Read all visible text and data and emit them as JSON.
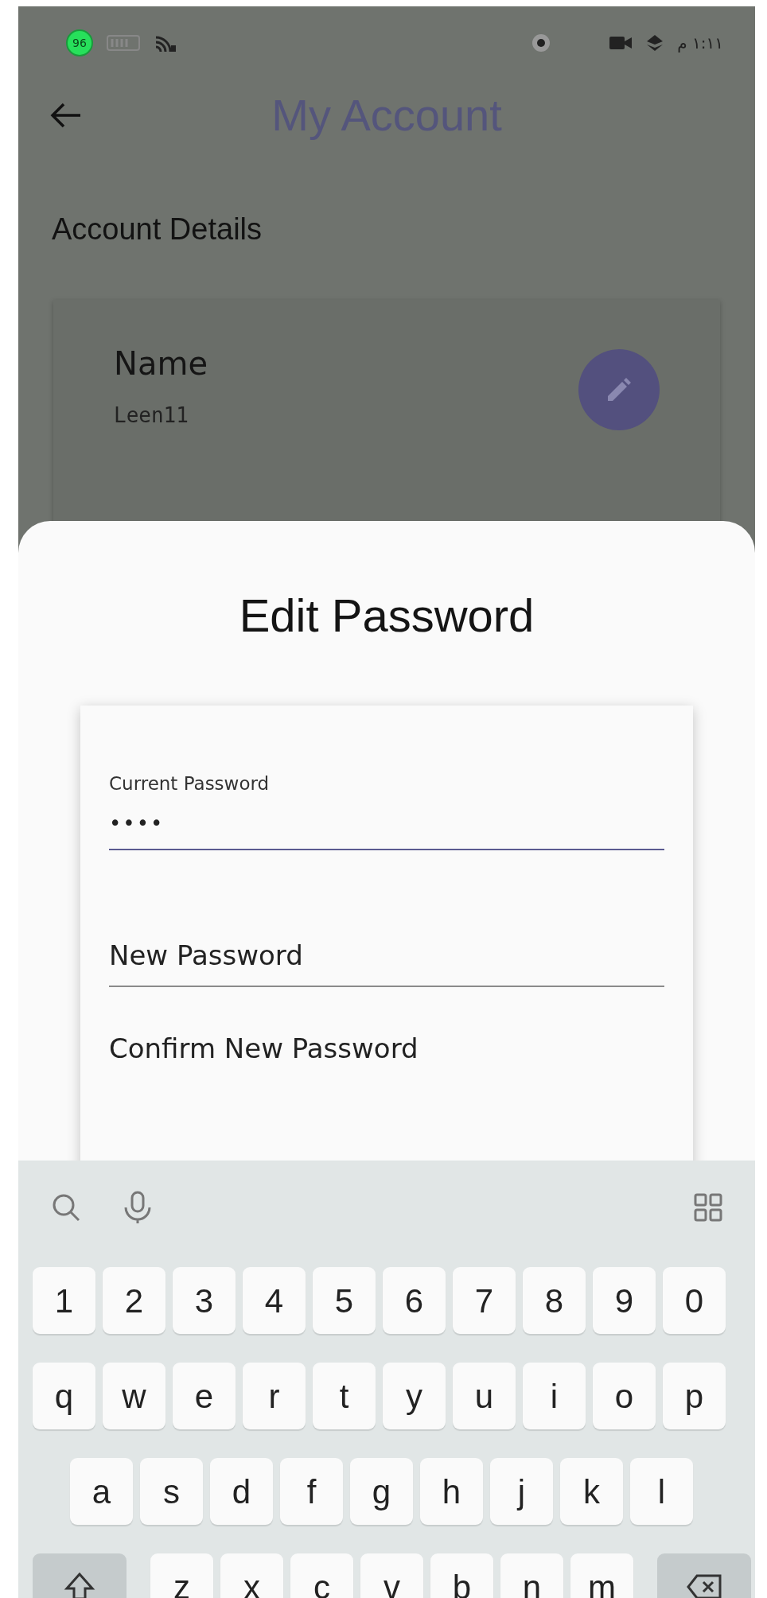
{
  "status_bar": {
    "battery": "96",
    "time": "١:١١ م"
  },
  "app_bar": {
    "title": "My Account"
  },
  "section_title": "Account Details",
  "name_card": {
    "label": "Name",
    "value": "Leen11"
  },
  "sheet": {
    "title": "Edit Password",
    "fields": [
      {
        "label": "Current Password",
        "value": "••••",
        "focused": true
      },
      {
        "label": "New Password",
        "focused": false
      },
      {
        "label": "Confirm New Password",
        "focused": false
      }
    ]
  },
  "keyboard": {
    "rows": [
      {
        "kind": "numbers",
        "keys": [
          "1",
          "2",
          "3",
          "4",
          "5",
          "6",
          "7",
          "8",
          "9",
          "0"
        ]
      },
      {
        "kind": "letters",
        "keys": [
          "q",
          "w",
          "e",
          "r",
          "t",
          "y",
          "u",
          "i",
          "o",
          "p"
        ]
      },
      {
        "kind": "indented",
        "keys": [
          "a",
          "s",
          "d",
          "f",
          "g",
          "h",
          "j",
          "k",
          "l"
        ]
      },
      {
        "kind": "shift",
        "keys": [
          "z",
          "x",
          "c",
          "v",
          "b",
          "n",
          "m"
        ]
      }
    ]
  }
}
